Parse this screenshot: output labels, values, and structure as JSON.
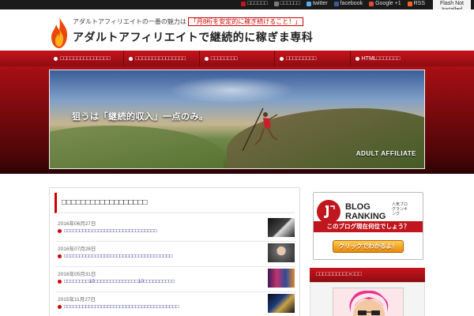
{
  "topbar": {
    "links": [
      {
        "label": "□□□□□□",
        "icon": "square-icon",
        "color": "#c0161d"
      },
      {
        "label": "□□□□□□",
        "icon": "square-icon",
        "color": "#7a7a7a"
      },
      {
        "label": "twitter",
        "icon": "twitter-icon",
        "color": "#55acee"
      },
      {
        "label": "facebook",
        "icon": "facebook-icon",
        "color": "#3b5998"
      },
      {
        "label": "Google +1",
        "icon": "google-plus-icon",
        "color": "#dd4b39"
      },
      {
        "label": "RSS",
        "icon": "rss-icon",
        "color": "#f26522"
      }
    ],
    "flash_note": "Flash Not Installed"
  },
  "header": {
    "tagline_prefix": "アダルトアフィリエイトの一番の魅力は",
    "tagline_highlight": "「月8桁を安定的に稼ぎ続けること！」",
    "site_title": "アダルトアフィリエイトで継続的に稼ぎま専科"
  },
  "nav": {
    "items": [
      {
        "label": "□□□□□□□□□□□□□□□"
      },
      {
        "label": "□□□□□□□□□□□□□□□"
      },
      {
        "label": "□□□□□□□□"
      },
      {
        "label": "□□□□□□□□□"
      },
      {
        "label": "HTML□□□□□□□"
      }
    ]
  },
  "hero": {
    "headline": "狙うは「継続的収入」一点のみ。",
    "brand": "ADULT AFFILIATE"
  },
  "main": {
    "section_title": "□□□□□□□□□□□□□□□□□□",
    "posts": [
      {
        "date": "2016年06月27日",
        "title": "□□□□□□□□□□□□□□□□□□□□□□□□□□□□□□"
      },
      {
        "date": "2016年07月28日",
        "title": "□□□□□□□□□□□□□□□□□□□□□□□□□□□□□□□□□□□"
      },
      {
        "date": "2016年05月31日",
        "title": "□□□□□□□□10□□□□□□□□□□□□□□10□□□□□□□□□□"
      },
      {
        "date": "2015年11月27日",
        "title": "□□□□□□□□□□□□□□□□□□□□□□□□□□□□□□□□□□□□□"
      }
    ]
  },
  "sidebar": {
    "ranking": {
      "top_text": "BLOG RANKING",
      "sub_text": "人気ブログランキング",
      "banner_text": "このブログ現在何位でしょう？",
      "button_text": "クリックでわかるよ！"
    },
    "profile_heading": "□□□□□□□□□□-□□□"
  },
  "colors": {
    "brand_red": "#c0161d",
    "nav_dark": "#8e0c12",
    "link_blue": "#1a1a8c"
  }
}
